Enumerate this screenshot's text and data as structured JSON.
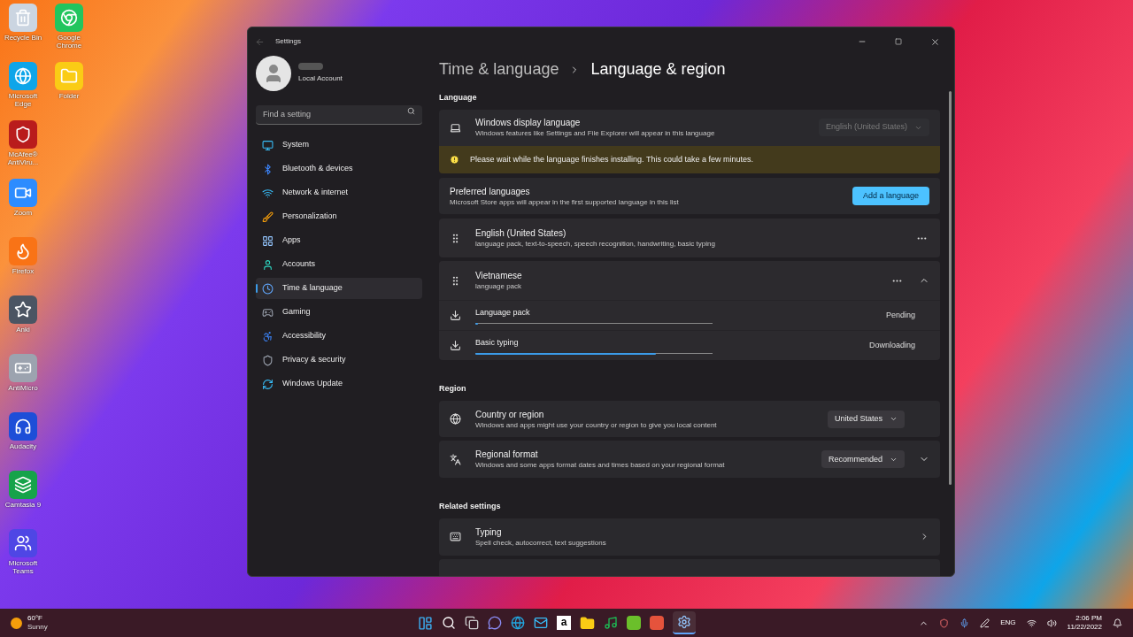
{
  "desktop": {
    "column_1": [
      {
        "label": "Recycle Bin"
      },
      {
        "label": "Microsoft Edge"
      },
      {
        "label": "McAfee® AntiViru..."
      },
      {
        "label": "Zoom"
      },
      {
        "label": "Firefox"
      },
      {
        "label": "Anki"
      },
      {
        "label": "AntiMicro"
      },
      {
        "label": "Audacity"
      },
      {
        "label": "Camtasia 9"
      },
      {
        "label": "Microsoft Teams"
      }
    ],
    "column_2": [
      {
        "label": "Google Chrome"
      },
      {
        "label": "Folder"
      }
    ]
  },
  "window": {
    "title": "Settings",
    "account": {
      "subtitle": "Local Account"
    },
    "search": {
      "placeholder": "Find a setting"
    },
    "sidebar": {
      "items": [
        {
          "label": "System",
          "selected": false
        },
        {
          "label": "Bluetooth & devices",
          "selected": false
        },
        {
          "label": "Network & internet",
          "selected": false
        },
        {
          "label": "Personalization",
          "selected": false
        },
        {
          "label": "Apps",
          "selected": false
        },
        {
          "label": "Accounts",
          "selected": false
        },
        {
          "label": "Time & language",
          "selected": true
        },
        {
          "label": "Gaming",
          "selected": false
        },
        {
          "label": "Accessibility",
          "selected": false
        },
        {
          "label": "Privacy & security",
          "selected": false
        },
        {
          "label": "Windows Update",
          "selected": false
        }
      ]
    },
    "breadcrumb": [
      "Time & language",
      "Language & region"
    ],
    "language": {
      "heading": "Language",
      "display_language": {
        "title": "Windows display language",
        "description": "Windows features like Settings and File Explorer will appear in this language",
        "value": "English (United States)",
        "disabled": true
      },
      "warning": "Please wait while the language finishes installing. This could take a few minutes.",
      "preferred": {
        "title": "Preferred languages",
        "description": "Microsoft Store apps will appear in the first supported language in this list",
        "button": "Add a language"
      },
      "languages": [
        {
          "name": "English (United States)",
          "features": "language pack, text-to-speech, speech recognition, handwriting, basic typing"
        },
        {
          "name": "Vietnamese",
          "features": "language pack",
          "expanded": true,
          "downloads": [
            {
              "name": "Language pack",
              "status": "Pending",
              "level": 0.01
            },
            {
              "name": "Basic typing",
              "status": "Downloading",
              "level": 0.76
            }
          ]
        }
      ]
    },
    "region": {
      "heading": "Region",
      "rows": [
        {
          "title": "Country or region",
          "description": "Windows and apps might use your country or region to give you local content",
          "value": "United States"
        },
        {
          "title": "Regional format",
          "description": "Windows and some apps format dates and times based on your regional format",
          "value": "Recommended",
          "expanded": false
        }
      ]
    },
    "related": {
      "heading": "Related settings",
      "rows": [
        {
          "title": "Typing",
          "description": "Spell check, autocorrect, text suggestions"
        }
      ]
    }
  },
  "taskbar": {
    "weather": {
      "temperature": "60°F",
      "condition": "Sunny"
    },
    "amazon_letter": "a",
    "language": "ENG",
    "time": "2:06 PM",
    "date": "11/22/2022"
  }
}
